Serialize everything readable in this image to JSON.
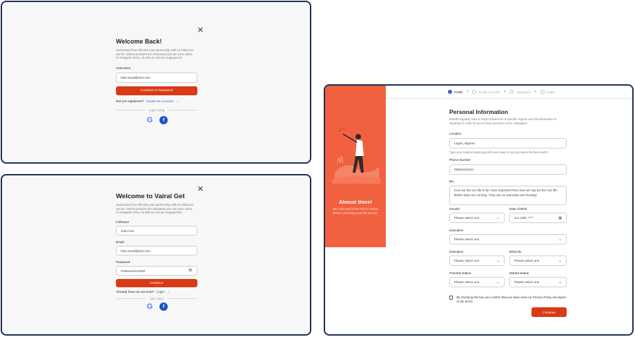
{
  "login": {
    "close": "×",
    "title": "Welcome Back!",
    "subtitle": "Understand how effective your partnership with an influencer can be. Gelinol provides the estimated price per post, video, or Instagram Story, as well as cost per engagement.",
    "username_label": "Username",
    "username_value": "fake.email@test.com",
    "continue_label": "Continue to Password",
    "not_registered": "Not yet registered?",
    "create_account": "Create an Account",
    "arrow": "→",
    "divider": "Login using",
    "google": "G",
    "facebook": "f"
  },
  "signup": {
    "close": "×",
    "title": "Welcome to Vairal Get",
    "subtitle": "Understand how effective your partnership with an influencer can be. Gelinol provides the estimated price per post, video, or Instagram Story, as well as cost per engagement.",
    "fullname_label": "Fullname",
    "fullname_value": "John Doe",
    "email_label": "Email",
    "email_value": "fake.email@test.com",
    "password_label": "Password",
    "password_value": "Password12345#",
    "eye": "👁",
    "continue_label": "Continue",
    "have_account": "Already have an account?",
    "login_link": "Login",
    "arrow": "→",
    "divider": "Sign using",
    "google": "G",
    "facebook": "f"
  },
  "profile": {
    "sidebar_title": "Almost there!",
    "sidebar_text": "We only need a few info to review before unlocking your full access.",
    "steps": [
      {
        "label": "Profile"
      },
      {
        "label": "Social Accounts"
      },
      {
        "label": "Categories"
      },
      {
        "label": "Avatar"
      }
    ],
    "step_check": "✓",
    "step_sep": "›",
    "title": "Personal Information",
    "subtitle": "Brands regularly want to target influencers to specific regions and this information is important in order for you to have access to more campaigns.",
    "location_label": "Location",
    "location_value": "Lagos, Nigeria",
    "location_hint": "Type your location beginning with your town or city and select the best match.",
    "phone_label": "Phone Number",
    "phone_value": "08034454322",
    "bio_label": "Bio",
    "bio_value": "How we live our life is far more important than how we say we live our life. Better days are coming. They are on Saturday and Sunday.",
    "gender_label": "Gender",
    "gender_value": "Please select one",
    "dob_label": "Date of Birth",
    "dob_value": "Jun 10th, ****",
    "education1_label": "Education",
    "education1_value": "Please select one",
    "education2_label": "Education",
    "education2_value": "Please select one",
    "ethnicity_label": "Ethnicity",
    "ethnicity_value": "Please select one",
    "parental_label": "Parental Status",
    "parental_value": "Please select one",
    "marital_label": "Marital Status",
    "marital_value": "Please select one",
    "agree_text": "By checking this box you confirm that you have read our Privacy Policy and agree to the terms.",
    "continue_label": "Continue",
    "chev": "⌄",
    "calendar": "▦"
  },
  "colors": {
    "accent": "#d93a16",
    "sidebar": "#f2613f",
    "link": "#2e56d6",
    "frame": "#1b2d55"
  }
}
